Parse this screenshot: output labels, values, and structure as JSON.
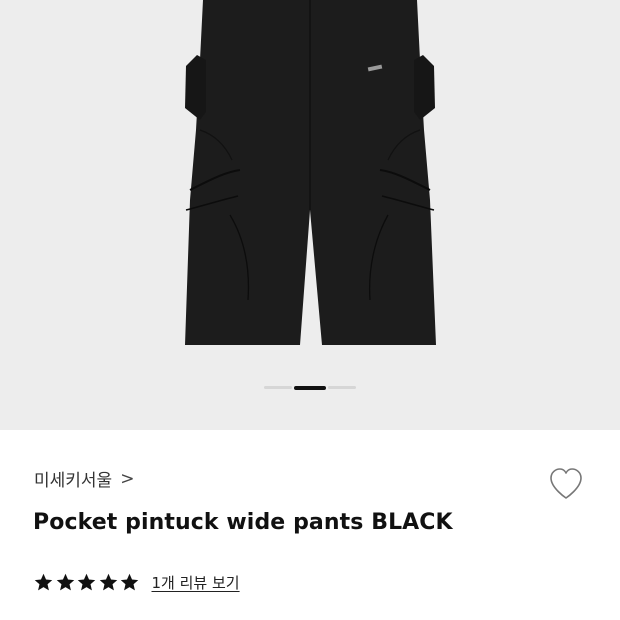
{
  "product": {
    "brand": "미세키서울",
    "brand_chevron": ">",
    "title": "Pocket pintuck wide pants BLACK",
    "image_icon": "black-wide-pants-photo"
  },
  "gallery": {
    "background": "#ededed",
    "active_index": 1,
    "dot_count": 3
  },
  "rating": {
    "stars": 5,
    "max": 5,
    "review_link": "1개 리뷰 보기",
    "star_color": "#111111"
  },
  "icons": {
    "wishlist": "heart-outline-icon",
    "star": "star-icon"
  }
}
